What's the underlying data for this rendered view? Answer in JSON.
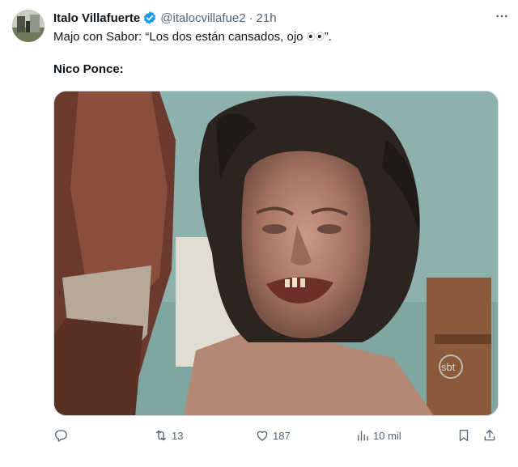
{
  "tweet": {
    "author_name": "Italo Villafuerte",
    "author_handle": "@italocvillafue2",
    "separator": "·",
    "time": "21h",
    "text_line1": "Majo con Sabor: “Los dos están cansados, ojo",
    "text_line1_end": "”.",
    "text_line2": "Nico Ponce:",
    "media_watermark": "sbt"
  },
  "actions": {
    "reply_count": "",
    "retweet_count": "13",
    "like_count": "187",
    "views_count": "10 mil"
  },
  "icons": {
    "verified": "verified-badge-icon",
    "more": "more-icon",
    "reply": "reply-icon",
    "retweet": "retweet-icon",
    "like": "like-icon",
    "views": "views-icon",
    "bookmark": "bookmark-icon",
    "share": "share-icon",
    "eyes_emoji": "eyes-emoji-icon"
  },
  "colors": {
    "verified": "#1d9bf0",
    "muted": "#536471",
    "text": "#0f1419"
  }
}
